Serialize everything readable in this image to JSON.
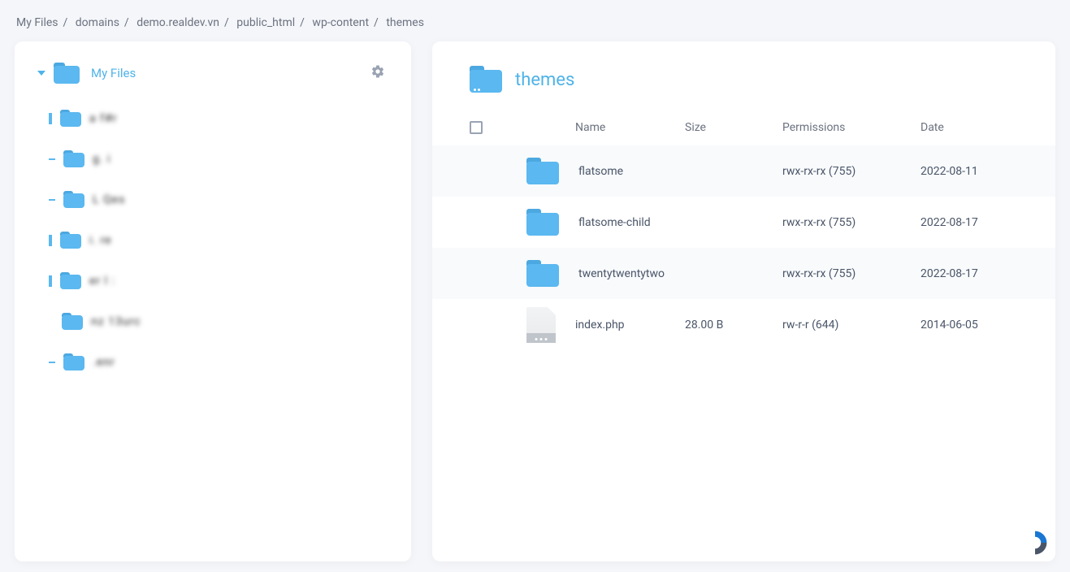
{
  "breadcrumb": [
    "My Files",
    "domains",
    "demo.realdev.vn",
    "public_html",
    "wp-content",
    "themes"
  ],
  "sidebar": {
    "root_label": "My Files",
    "items": [
      {
        "label": "a f#r"
      },
      {
        "label": "g. i"
      },
      {
        "label": "L Qes"
      },
      {
        "label": "i. re"
      },
      {
        "label": "er l :"
      },
      {
        "label": "nz 13urc",
        "indent": true
      },
      {
        "label": ".enr"
      }
    ]
  },
  "main": {
    "folder_title": "themes",
    "columns": {
      "name": "Name",
      "size": "Size",
      "permissions": "Permissions",
      "date": "Date"
    },
    "rows": [
      {
        "type": "folder",
        "name": "flatsome",
        "size": "",
        "perm": "rwx-rx-rx (755)",
        "date": "2022-08-11"
      },
      {
        "type": "folder",
        "name": "flatsome-child",
        "size": "",
        "perm": "rwx-rx-rx (755)",
        "date": "2022-08-17"
      },
      {
        "type": "folder",
        "name": "twentytwentytwo",
        "size": "",
        "perm": "rwx-rx-rx (755)",
        "date": "2022-08-17"
      },
      {
        "type": "file",
        "name": "index.php",
        "size": "28.00 B",
        "perm": "rw-r-r (644)",
        "date": "2014-06-05"
      }
    ]
  }
}
